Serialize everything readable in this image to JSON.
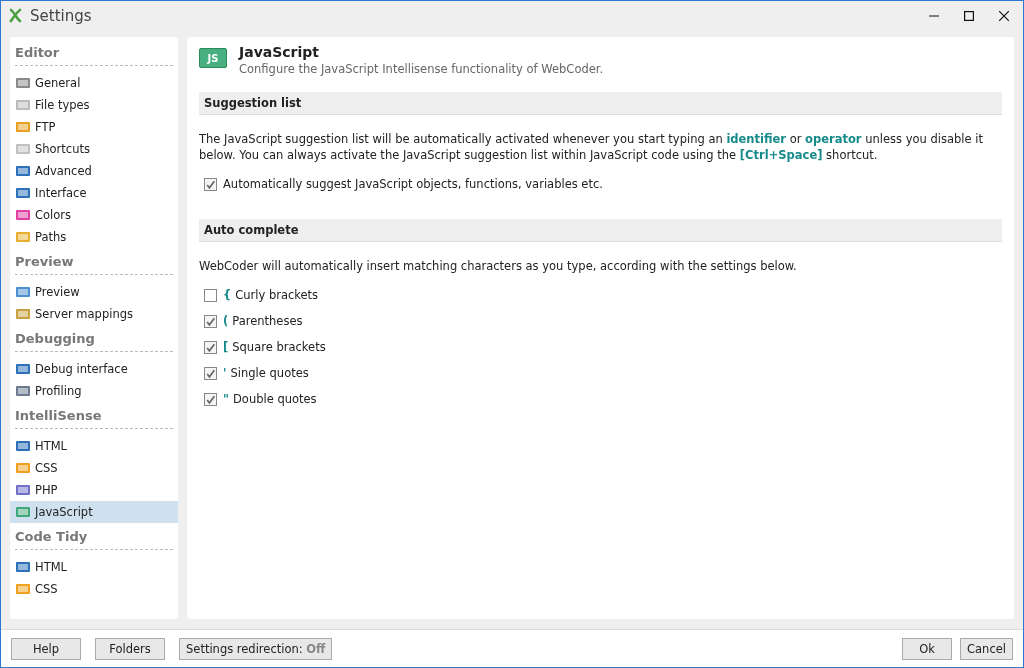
{
  "window": {
    "title": "Settings"
  },
  "sidebar": {
    "groups": [
      {
        "title": "Editor",
        "items": [
          {
            "label": "General",
            "selected": false
          },
          {
            "label": "File types",
            "selected": false
          },
          {
            "label": "FTP",
            "selected": false
          },
          {
            "label": "Shortcuts",
            "selected": false
          },
          {
            "label": "Advanced",
            "selected": false
          },
          {
            "label": "Interface",
            "selected": false
          },
          {
            "label": "Colors",
            "selected": false
          },
          {
            "label": "Paths",
            "selected": false
          }
        ]
      },
      {
        "title": "Preview",
        "items": [
          {
            "label": "Preview",
            "selected": false
          },
          {
            "label": "Server mappings",
            "selected": false
          }
        ]
      },
      {
        "title": "Debugging",
        "items": [
          {
            "label": "Debug interface",
            "selected": false
          },
          {
            "label": "Profiling",
            "selected": false
          }
        ]
      },
      {
        "title": "IntelliSense",
        "items": [
          {
            "label": "HTML",
            "selected": false
          },
          {
            "label": "CSS",
            "selected": false
          },
          {
            "label": "PHP",
            "selected": false
          },
          {
            "label": "JavaScript",
            "selected": true
          }
        ]
      },
      {
        "title": "Code Tidy",
        "items": [
          {
            "label": "HTML",
            "selected": false
          },
          {
            "label": "CSS",
            "selected": false
          }
        ]
      }
    ]
  },
  "page": {
    "badge": "JS",
    "title": "JavaScript",
    "subtitle": "Configure the JavaScript Intellisense functionality of WebCoder.",
    "sections": [
      {
        "title": "Suggestion list",
        "text": "The JavaScript suggestion list will be automatically activated whenever you start typing an **identifier** or **operator** unless you disable it below. You can always activate the JavaScript suggestion list within JavaScript code using the **[Ctrl+Space]** shortcut.",
        "options": [
          {
            "label": "Automatically suggest JavaScript objects, functions, variables etc.",
            "checked": true
          }
        ]
      },
      {
        "title": "Auto complete",
        "text": "WebCoder will automatically insert matching characters as you type, according with the settings below.",
        "options": [
          {
            "symbol": "{",
            "label": "Curly brackets",
            "checked": false
          },
          {
            "symbol": "(",
            "label": "Parentheses",
            "checked": true
          },
          {
            "symbol": "[",
            "label": "Square brackets",
            "checked": true
          },
          {
            "symbol": "'",
            "label": "Single quotes",
            "checked": true
          },
          {
            "symbol": "\"",
            "label": "Double quotes",
            "checked": true
          }
        ]
      }
    ]
  },
  "footer": {
    "left": [
      "Help",
      "Folders",
      "Settings redirection: **Off**"
    ],
    "right": [
      "Ok",
      "Cancel"
    ]
  }
}
